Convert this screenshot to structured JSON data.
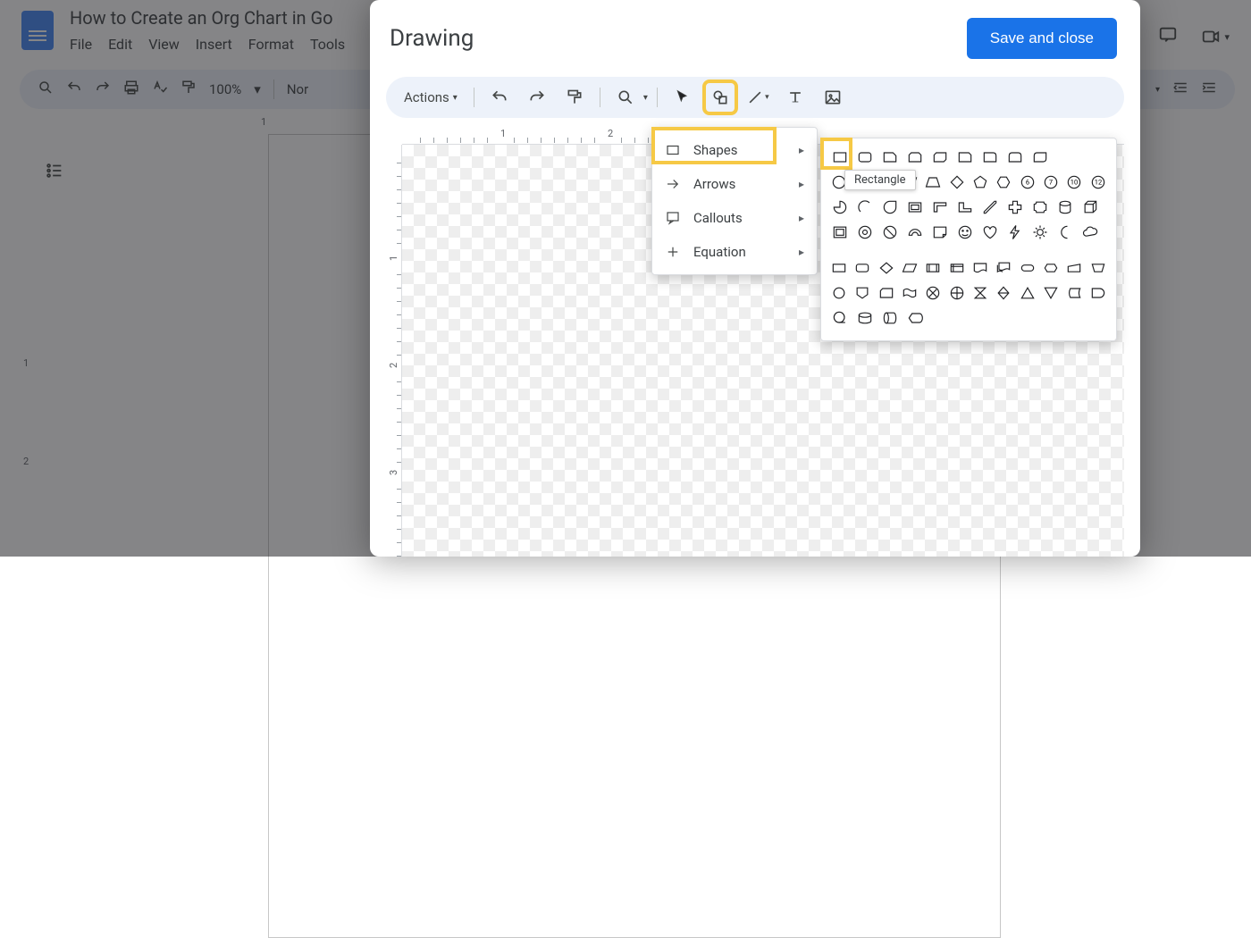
{
  "app": {
    "doc_title": "How to Create an Org Chart in Go",
    "menus": [
      "File",
      "Edit",
      "View",
      "Insert",
      "Format",
      "Tools"
    ],
    "zoom": "100%",
    "font_style_trunc": "Nor"
  },
  "dialog": {
    "title": "Drawing",
    "save_label": "Save and close",
    "actions_label": "Actions"
  },
  "shape_menu": {
    "items": [
      {
        "label": "Shapes",
        "icon": "rect-outline"
      },
      {
        "label": "Arrows",
        "icon": "arrow-right"
      },
      {
        "label": "Callouts",
        "icon": "callout"
      },
      {
        "label": "Equation",
        "icon": "plus"
      }
    ]
  },
  "tooltip": "Rectangle",
  "palette_rows": {
    "group1": 4,
    "group2": 3
  }
}
